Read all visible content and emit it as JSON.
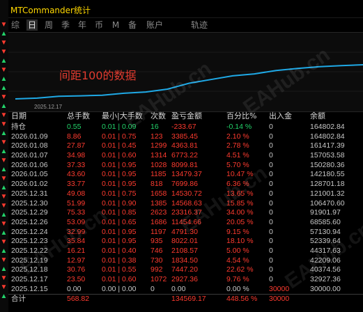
{
  "window": {
    "title": "MTCommander统计"
  },
  "tabs": [
    {
      "label": "综",
      "active": false
    },
    {
      "label": "日",
      "active": true
    },
    {
      "label": "周",
      "active": false
    },
    {
      "label": "季",
      "active": false
    },
    {
      "label": "年",
      "active": false
    },
    {
      "label": "币",
      "active": false
    },
    {
      "label": "M",
      "active": false
    },
    {
      "label": "备",
      "active": false
    },
    {
      "label": "账户",
      "active": false
    },
    {
      "label": "轨迹",
      "active": false
    }
  ],
  "chart": {
    "annotation": "间距100的数据",
    "start_date": "2025.12.17",
    "line_color": "#1fa9e6"
  },
  "watermark": "EAHub.cn",
  "table": {
    "headers": [
      "日期",
      "总手数",
      "最小|大手数",
      "次数",
      "盈亏金额",
      "百分比%",
      "出入金",
      "余额"
    ],
    "holding": {
      "date": "持仓",
      "lots": "0.55",
      "minmax": "0.01 | 0.09",
      "count": "16",
      "pnl": "-233.67",
      "pct": "-0.14 %",
      "flow": "0",
      "balance": "164802.84"
    },
    "rows": [
      {
        "date": "2026.01.09",
        "lots": "8.86",
        "minmax": "0.01 | 0.75",
        "count": "123",
        "pnl": "3385.45",
        "pct": "2.10 %",
        "flow": "0",
        "balance": "164802.84"
      },
      {
        "date": "2026.01.08",
        "lots": "27.87",
        "minmax": "0.01 | 0.45",
        "count": "1299",
        "pnl": "4363.81",
        "pct": "2.78 %",
        "flow": "0",
        "balance": "161417.39"
      },
      {
        "date": "2026.01.07",
        "lots": "34.98",
        "minmax": "0.01 | 0.60",
        "count": "1314",
        "pnl": "6773.22",
        "pct": "4.51 %",
        "flow": "0",
        "balance": "157053.58"
      },
      {
        "date": "2026.01.06",
        "lots": "37.33",
        "minmax": "0.01 | 0.95",
        "count": "1028",
        "pnl": "8099.81",
        "pct": "5.70 %",
        "flow": "0",
        "balance": "150280.36"
      },
      {
        "date": "2026.01.05",
        "lots": "43.60",
        "minmax": "0.01 | 0.95",
        "count": "1185",
        "pnl": "13479.37",
        "pct": "10.47 %",
        "flow": "0",
        "balance": "142180.55"
      },
      {
        "date": "2026.01.02",
        "lots": "33.77",
        "minmax": "0.01 | 0.95",
        "count": "818",
        "pnl": "7699.86",
        "pct": "6.36 %",
        "flow": "0",
        "balance": "128701.18"
      },
      {
        "date": "2025.12.31",
        "lots": "49.08",
        "minmax": "0.01 | 0.75",
        "count": "1658",
        "pnl": "14530.72",
        "pct": "13.65 %",
        "flow": "0",
        "balance": "121001.32"
      },
      {
        "date": "2025.12.30",
        "lots": "51.99",
        "minmax": "0.01 | 0.90",
        "count": "1385",
        "pnl": "14568.63",
        "pct": "15.85 %",
        "flow": "0",
        "balance": "106470.60"
      },
      {
        "date": "2025.12.29",
        "lots": "75.33",
        "minmax": "0.01 | 0.85",
        "count": "2623",
        "pnl": "23316.37",
        "pct": "34.00 %",
        "flow": "0",
        "balance": "91901.97"
      },
      {
        "date": "2025.12.26",
        "lots": "53.09",
        "minmax": "0.01 | 0.65",
        "count": "1686",
        "pnl": "11454.66",
        "pct": "20.05 %",
        "flow": "0",
        "balance": "68585.60"
      },
      {
        "date": "2025.12.24",
        "lots": "32.99",
        "minmax": "0.01 | 0.95",
        "count": "1197",
        "pnl": "4791.30",
        "pct": "9.15 %",
        "flow": "0",
        "balance": "57130.94"
      },
      {
        "date": "2025.12.23",
        "lots": "35.84",
        "minmax": "0.01 | 0.95",
        "count": "935",
        "pnl": "8022.01",
        "pct": "18.10 %",
        "flow": "0",
        "balance": "52339.64"
      },
      {
        "date": "2025.12.22",
        "lots": "16.21",
        "minmax": "0.01 | 0.40",
        "count": "746",
        "pnl": "2108.57",
        "pct": "5.00 %",
        "flow": "0",
        "balance": "44317.63"
      },
      {
        "date": "2025.12.19",
        "lots": "12.97",
        "minmax": "0.01 | 0.38",
        "count": "730",
        "pnl": "1834.50",
        "pct": "4.54 %",
        "flow": "0",
        "balance": "42209.06"
      },
      {
        "date": "2025.12.18",
        "lots": "30.76",
        "minmax": "0.01 | 0.55",
        "count": "992",
        "pnl": "7447.20",
        "pct": "22.62 %",
        "flow": "0",
        "balance": "40374.56"
      },
      {
        "date": "2025.12.17",
        "lots": "23.50",
        "minmax": "0.01 | 0.60",
        "count": "1072",
        "pnl": "2927.36",
        "pct": "9.76 %",
        "flow": "0",
        "balance": "32927.36"
      },
      {
        "date": "2025.12.15",
        "lots": "0.00",
        "minmax": "0.00 | 0.00",
        "count": "0",
        "pnl": "0.00",
        "pct": "0.00 %",
        "flow": "30000",
        "balance": "30000.00"
      }
    ],
    "total": {
      "date": "合计",
      "lots": "568.82",
      "minmax": "",
      "count": "",
      "pnl": "134569.17",
      "pct": "448.56 %",
      "flow": "30000",
      "balance": ""
    },
    "colors": {
      "row": "#ff3b2f",
      "holding": "#22d36a",
      "holding_pnl": "#ff3b2f",
      "date": "#c8c8c8",
      "neutral": "#c8c8c8"
    }
  }
}
